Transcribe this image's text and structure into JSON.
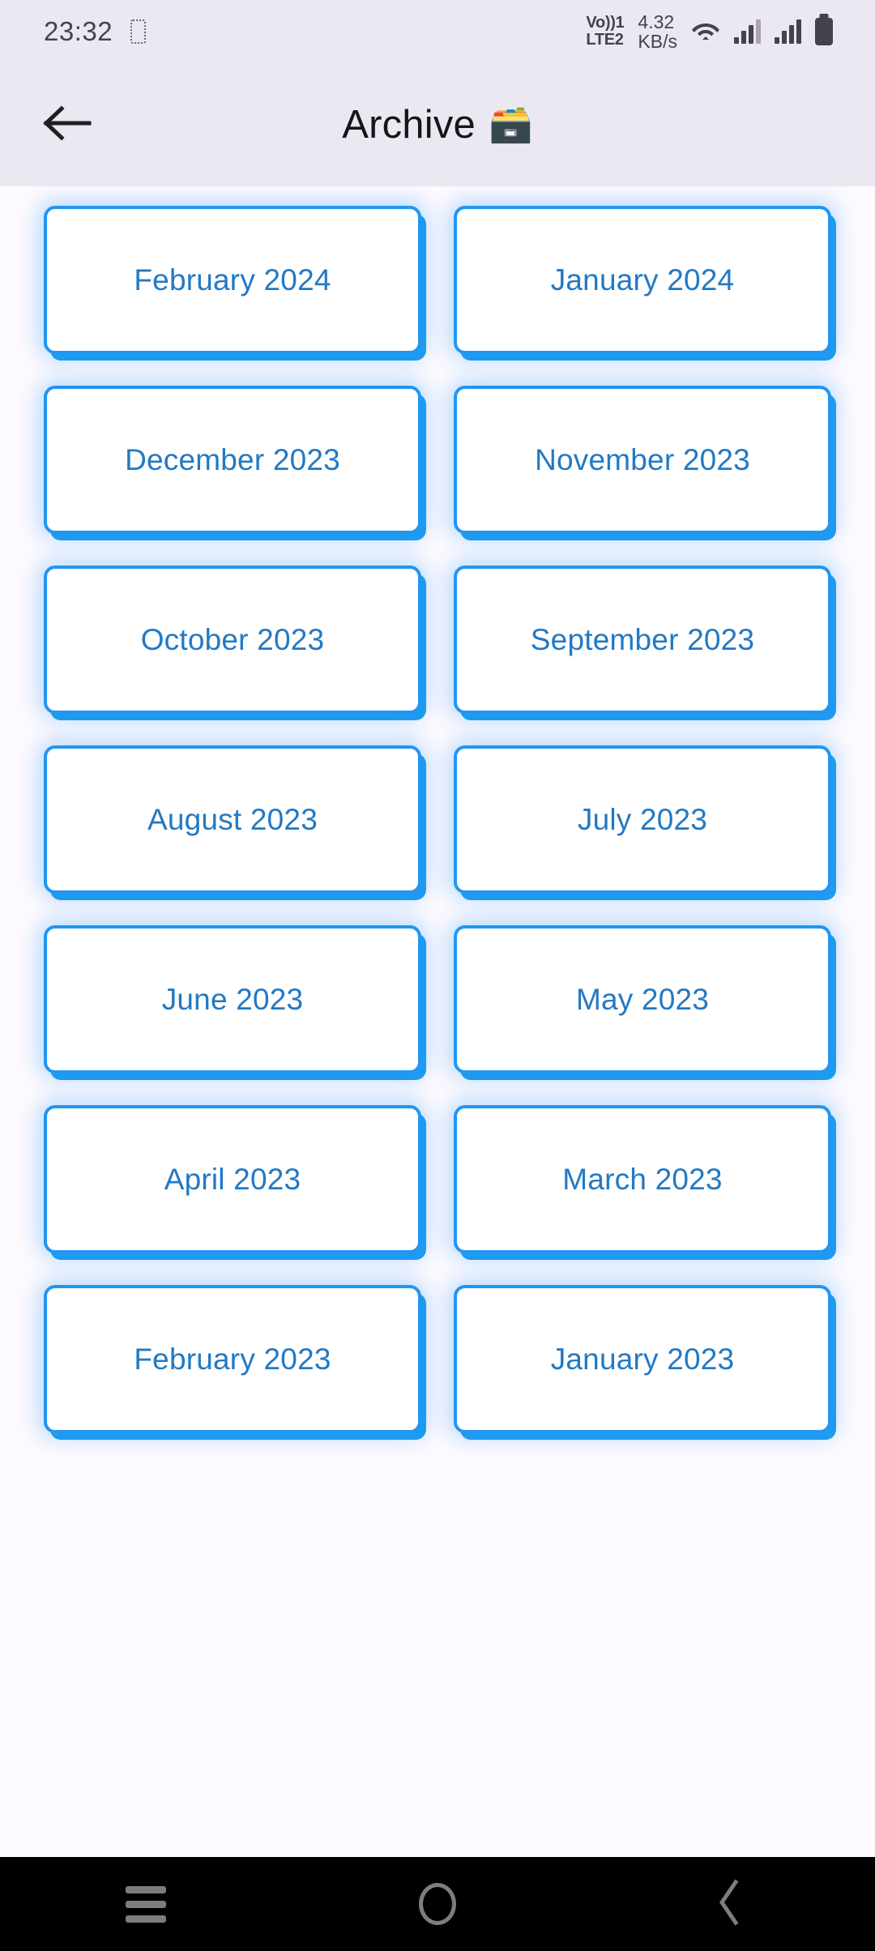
{
  "status_bar": {
    "clock": "23:32",
    "notification_icon": "notification-placeholder-icon",
    "volte_line1": "Vo))1",
    "volte_line2": "LTE2",
    "net_speed_value": "4.32",
    "net_speed_unit": "KB/s",
    "wifi_icon": "wifi-icon",
    "signal_icon_sim1": "signal-bars-icon",
    "signal_icon_sim2": "signal-bars-icon",
    "battery_icon": "battery-full-icon"
  },
  "header": {
    "back_icon": "arrow-left-icon",
    "title": "Archive",
    "emoji": "🗃️"
  },
  "archive": {
    "months": [
      {
        "label": "February 2024"
      },
      {
        "label": "January 2024"
      },
      {
        "label": "December 2023"
      },
      {
        "label": "November 2023"
      },
      {
        "label": "October 2023"
      },
      {
        "label": "September 2023"
      },
      {
        "label": "August 2023"
      },
      {
        "label": "July 2023"
      },
      {
        "label": "June 2023"
      },
      {
        "label": "May 2023"
      },
      {
        "label": "April 2023"
      },
      {
        "label": "March 2023"
      },
      {
        "label": "February 2023"
      },
      {
        "label": "January 2023"
      }
    ]
  },
  "nav_bar": {
    "recents_icon": "menu-recents-icon",
    "home_icon": "home-circle-icon",
    "back_icon": "chevron-left-icon"
  },
  "colors": {
    "accent_blue": "#2196f3",
    "card_text_blue": "#2279c4",
    "header_background": "#ece8f1",
    "page_background": "#fdfaff",
    "nav_background": "#000000",
    "nav_icon": "#7d7d7d"
  }
}
